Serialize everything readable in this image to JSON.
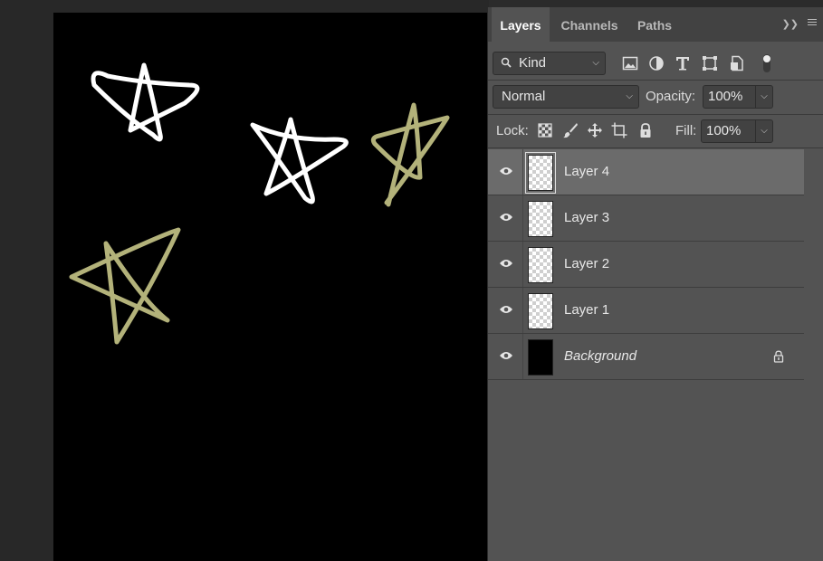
{
  "panel": {
    "tabs": [
      {
        "label": "Layers",
        "active": true
      },
      {
        "label": "Channels",
        "active": false
      },
      {
        "label": "Paths",
        "active": false
      }
    ],
    "expand_icon": "double-chevron-right-icon",
    "menu_icon": "hamburger-menu-icon"
  },
  "filter": {
    "kind_label": "Kind",
    "icons": [
      "image-filter-icon",
      "adjustment-filter-icon",
      "type-filter-icon",
      "shape-filter-icon",
      "smart-object-filter-icon",
      "filter-toggle-icon"
    ]
  },
  "blend": {
    "mode": "Normal",
    "opacity_label": "Opacity:",
    "opacity": "100%"
  },
  "lock": {
    "label": "Lock:",
    "icons": [
      "lock-transparent-pixels-icon",
      "lock-image-pixels-icon",
      "lock-position-icon",
      "lock-artboard-icon",
      "lock-all-icon"
    ],
    "fill_label": "Fill:",
    "fill": "100%"
  },
  "layers": [
    {
      "name": "Layer 4",
      "selected": true,
      "thumb": "transparent"
    },
    {
      "name": "Layer 3",
      "selected": false,
      "thumb": "transparent"
    },
    {
      "name": "Layer 2",
      "selected": false,
      "thumb": "transparent"
    },
    {
      "name": "Layer 1",
      "selected": false,
      "thumb": "transparent"
    },
    {
      "name": "Background",
      "selected": false,
      "thumb": "black",
      "locked": true
    }
  ],
  "colors": {
    "panel_bg": "#535353",
    "selected_layer": "#6b6b6b",
    "canvas": "#000000",
    "white_stroke": "#ffffff",
    "olive_stroke": "#b3b27a"
  }
}
